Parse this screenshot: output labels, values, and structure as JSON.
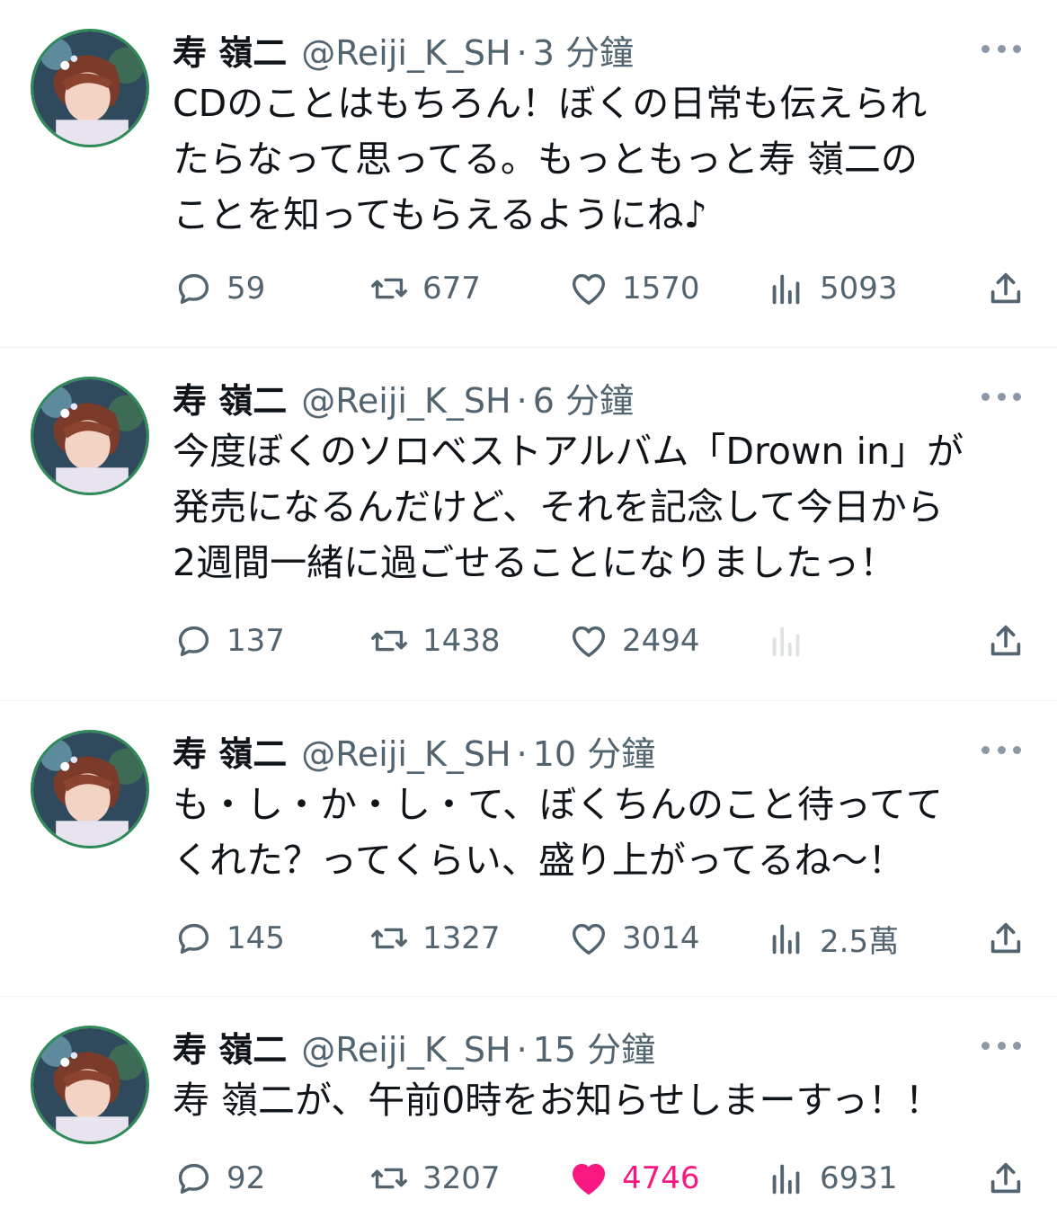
{
  "tweets": [
    {
      "name": "寿 嶺二",
      "handle": "@Reiji_K_SH",
      "separator": "·",
      "time": "3 分鐘",
      "text": "CDのことはもちろん！ぼくの日常も伝えられ\nたらなって思ってる。もっともっと寿 嶺二の\nことを知ってもらえるようにね♪",
      "replies": "59",
      "retweets": "677",
      "likes": "1570",
      "views": "5093",
      "liked": false
    },
    {
      "name": "寿 嶺二",
      "handle": "@Reiji_K_SH",
      "separator": "·",
      "time": "6 分鐘",
      "text": "今度ぼくのソロベストアルバム「Drown in」が\n発売になるんだけど、それを記念して今日から\n2週間一緒に過ごせることになりましたっ！",
      "replies": "137",
      "retweets": "1438",
      "likes": "2494",
      "views": "",
      "liked": false
    },
    {
      "name": "寿 嶺二",
      "handle": "@Reiji_K_SH",
      "separator": "·",
      "time": "10 分鐘",
      "text": "も・し・か・し・て、ぼくちんのこと待ってて\nくれた？ってくらい、盛り上がってるね～！",
      "replies": "145",
      "retweets": "1327",
      "likes": "3014",
      "views": "2.5萬",
      "liked": false
    },
    {
      "name": "寿 嶺二",
      "handle": "@Reiji_K_SH",
      "separator": "·",
      "time": "15 分鐘",
      "text": "寿 嶺二が、午前0時をお知らせしまーすっ！！",
      "replies": "92",
      "retweets": "3207",
      "likes": "4746",
      "views": "6931",
      "liked": true
    }
  ],
  "colors": {
    "text_primary": "#0f1419",
    "text_secondary": "#536471",
    "like_active": "#f91880",
    "divider": "#eff3f4",
    "avatar_ring": "#2e8b57"
  },
  "icons": [
    "more-icon",
    "reply-icon",
    "retweet-icon",
    "like-icon",
    "views-icon",
    "share-icon"
  ]
}
